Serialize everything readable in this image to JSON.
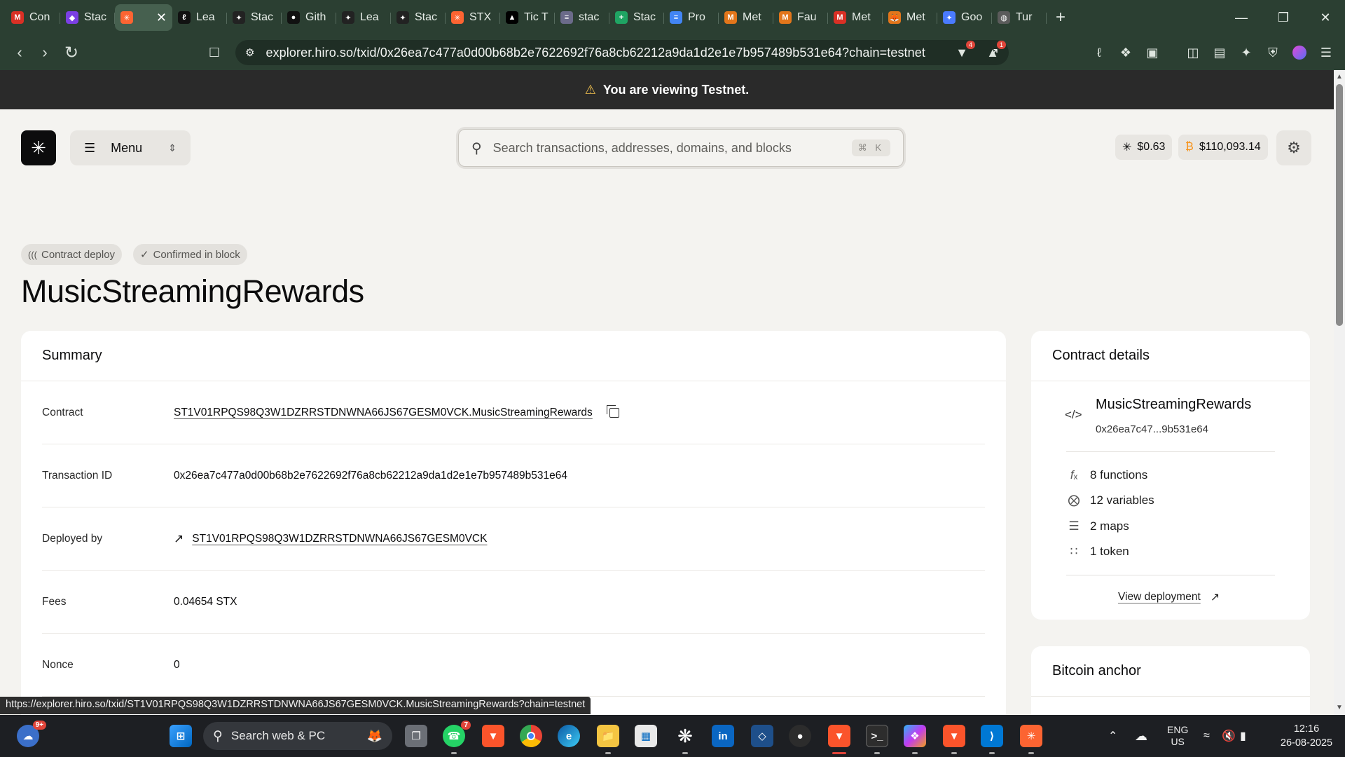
{
  "browser": {
    "tabs": [
      {
        "label": "Con",
        "icon": "gmail-icon",
        "color": "#d93025",
        "glyph": "M"
      },
      {
        "label": "Stac",
        "icon": "stacks-icon",
        "color": "#7b3fe4",
        "glyph": "◆"
      },
      {
        "label": "",
        "icon": "stacks-icon",
        "color": "#fc6432",
        "glyph": "✳",
        "active": true
      },
      {
        "label": "Lea",
        "icon": "leather-icon",
        "color": "#111111",
        "glyph": "ℓ"
      },
      {
        "label": "Stac",
        "icon": "stacks-icon",
        "color": "#222222",
        "glyph": "✦"
      },
      {
        "label": "Gith",
        "icon": "github-icon",
        "color": "#111111",
        "glyph": "●"
      },
      {
        "label": "Lea",
        "icon": "stacks-icon",
        "color": "#222222",
        "glyph": "✦"
      },
      {
        "label": "Stac",
        "icon": "stacks-icon",
        "color": "#222222",
        "glyph": "✦"
      },
      {
        "label": "STX",
        "icon": "stacks-icon",
        "color": "#fc6432",
        "glyph": "✳"
      },
      {
        "label": "Tic T",
        "icon": "vercel-icon",
        "color": "#000000",
        "glyph": "▲"
      },
      {
        "label": "stac",
        "icon": "db-icon",
        "color": "#6b6b8a",
        "glyph": "≡"
      },
      {
        "label": "Stac",
        "icon": "sheets-icon",
        "color": "#1fa463",
        "glyph": "+"
      },
      {
        "label": "Pro",
        "icon": "docs-icon",
        "color": "#4285f4",
        "glyph": "≡"
      },
      {
        "label": "Met",
        "icon": "metamask-icon",
        "color": "#e2761b",
        "glyph": "M"
      },
      {
        "label": "Fau",
        "icon": "metamask-icon",
        "color": "#e2761b",
        "glyph": "M"
      },
      {
        "label": "Met",
        "icon": "gmail-icon",
        "color": "#d93025",
        "glyph": "M"
      },
      {
        "label": "Met",
        "icon": "metamask-icon",
        "color": "#e2761b",
        "glyph": "🦊"
      },
      {
        "label": "Goo",
        "icon": "gemini-icon",
        "color": "#4a7bff",
        "glyph": "✦"
      },
      {
        "label": "Tur",
        "icon": "globe-icon",
        "color": "#5b5b5b",
        "glyph": "◍"
      }
    ],
    "url": "explorer.hiro.so/txid/0x26ea7c477a0d00b68b2e7622692f76a8cb62212a9da1d2e1e7b957489b531e64?chain=testnet",
    "badges": {
      "brave": "4",
      "alert": "1"
    }
  },
  "banner": {
    "text": "You are viewing Testnet."
  },
  "header": {
    "menu_label": "Menu",
    "search_placeholder": "Search transactions, addresses, domains, and blocks",
    "search_shortcut": "⌘ K",
    "stx_price": "$0.63",
    "btc_price": "$110,093.14"
  },
  "tx": {
    "tags": [
      "Contract deploy",
      "Confirmed in block"
    ],
    "title": "MusicStreamingRewards"
  },
  "summary": {
    "heading": "Summary",
    "rows": [
      {
        "label": "Contract",
        "value": "ST1V01RPQS98Q3W1DZRRSTDNWNA66JS67GESM0VCK.MusicStreamingRewards"
      },
      {
        "label": "Transaction ID",
        "value": "0x26ea7c477a0d00b68b2e7622692f76a8cb62212a9da1d2e1e7b957489b531e64"
      },
      {
        "label": "Deployed by",
        "value": "ST1V01RPQS98Q3W1DZRRSTDNWNA66JS67GESM0VCK"
      },
      {
        "label": "Fees",
        "value": "0.04654 STX"
      },
      {
        "label": "Nonce",
        "value": "0"
      }
    ]
  },
  "contract_details": {
    "heading": "Contract details",
    "name": "MusicStreamingRewards",
    "short_hash": "0x26ea7c47...9b531e64",
    "stats": [
      "8 functions",
      "12 variables",
      "2 maps",
      "1 token"
    ],
    "view_deployment": "View deployment"
  },
  "bitcoin_anchor": {
    "heading": "Bitcoin anchor"
  },
  "status_url": "https://explorer.hiro.so/txid/ST1V01RPQS98Q3W1DZRRSTDNWNA66JS67GESM0VCK.MusicStreamingRewards?chain=testnet",
  "taskbar": {
    "search_label": "Search web & PC",
    "weather_badge": "9+",
    "whatsapp_badge": "7",
    "lang": "ENG",
    "region": "US",
    "time": "12:16",
    "date": "26-08-2025"
  }
}
